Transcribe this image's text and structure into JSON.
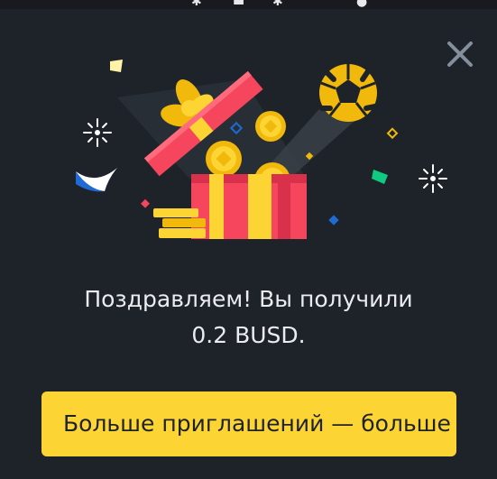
{
  "modal": {
    "message_line1": "Поздравляем! Вы получили",
    "message_line2": "0.2 BUSD.",
    "cta_label": "Больше приглашений — больше наград",
    "close_icon": "close-icon"
  },
  "colors": {
    "background": "#1e2329",
    "accent_yellow": "#fcd535",
    "text": "#eaecef",
    "gift_red": "#f6465d",
    "close_gray": "#848e9c"
  }
}
